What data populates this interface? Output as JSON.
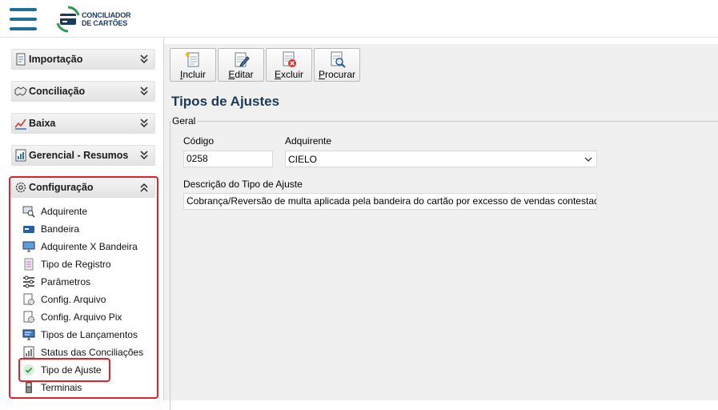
{
  "header": {
    "logo_line1": "CONCILIADOR",
    "logo_line2": "DE CARTÕES"
  },
  "sidebar": {
    "sections": [
      {
        "label": "Importação",
        "icon": "import-icon",
        "expanded": false
      },
      {
        "label": "Conciliação",
        "icon": "handshake-icon",
        "expanded": false
      },
      {
        "label": "Baixa",
        "icon": "chart-check-icon",
        "expanded": false
      },
      {
        "label": "Gerencial - Resumos",
        "icon": "report-icon",
        "expanded": false
      },
      {
        "label": "Configuração",
        "icon": "gear-icon",
        "expanded": true
      }
    ],
    "config_items": [
      {
        "label": "Adquirente",
        "icon": "search-card-icon"
      },
      {
        "label": "Bandeira",
        "icon": "card-flag-icon"
      },
      {
        "label": "Adquirente X Bandeira",
        "icon": "monitor-icon"
      },
      {
        "label": "Tipo de Registro",
        "icon": "document-icon"
      },
      {
        "label": "Parâmetros",
        "icon": "sliders-icon"
      },
      {
        "label": "Config. Arquivo",
        "icon": "file-gear-icon"
      },
      {
        "label": "Config. Arquivo Pix",
        "icon": "file-gear-icon"
      },
      {
        "label": "Tipos de Lançamentos",
        "icon": "monitor-list-icon"
      },
      {
        "label": "Status das Conciliações",
        "icon": "status-icon"
      },
      {
        "label": "Tipo de Ajuste",
        "icon": "check-circle-icon",
        "active": true
      },
      {
        "label": "Terminais",
        "icon": "pos-terminal-icon"
      }
    ]
  },
  "toolbar": {
    "buttons": [
      {
        "label": "Incluir",
        "icon": "new-document-icon"
      },
      {
        "label": "Editar",
        "icon": "edit-document-icon"
      },
      {
        "label": "Excluir",
        "icon": "delete-document-icon"
      },
      {
        "label": "Procurar",
        "icon": "search-document-icon"
      }
    ]
  },
  "form": {
    "title": "Tipos de Ajustes",
    "group_label": "Geral",
    "codigo_label": "Código",
    "codigo_value": "0258",
    "adquirente_label": "Adquirente",
    "adquirente_value": "CIELO",
    "descricao_label": "Descrição do Tipo de Ajuste",
    "descricao_value": "Cobrança/Reversão de multa aplicada pela bandeira do cartão por excesso de vendas contestadas"
  },
  "colors": {
    "accent": "#1e6f98",
    "highlight": "#e0222a",
    "title": "#1a3a56"
  }
}
